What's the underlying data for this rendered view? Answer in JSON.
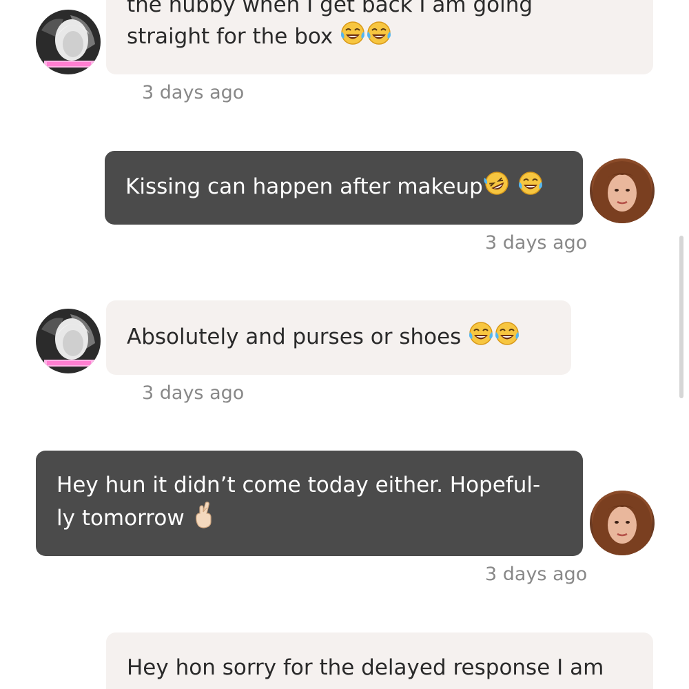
{
  "messages": [
    {
      "id": "m1",
      "direction": "incoming",
      "lines": [
        "the hubby when I get back I am going",
        "straight for the box"
      ],
      "emoji": [
        "tears-of-joy",
        "tears-of-joy"
      ],
      "time": "3 days ago"
    },
    {
      "id": "m2",
      "direction": "outgoing",
      "lines": [
        "Kissing can happen after makeup"
      ],
      "emoji": [
        "rolling-on-floor-laughing",
        "tears-of-joy"
      ],
      "time": "3 days ago"
    },
    {
      "id": "m3",
      "direction": "incoming",
      "lines": [
        "Absolutely and purses or shoes"
      ],
      "emoji": [
        "tears-of-joy",
        "tears-of-joy"
      ],
      "time": "3 days ago"
    },
    {
      "id": "m4",
      "direction": "outgoing",
      "lines": [
        "Hey hun it didn’t come today either. Hopeful-",
        "ly tomorrow"
      ],
      "emoji": [
        "crossed-fingers"
      ],
      "time": "3 days ago"
    },
    {
      "id": "m5",
      "direction": "incoming",
      "lines": [
        "Hey hon sorry for the delayed response I am"
      ],
      "emoji": []
    }
  ],
  "colors": {
    "incoming_bubble": "#f5f1ef",
    "outgoing_bubble": "#4b4b4b",
    "timestamp": "#888888"
  }
}
